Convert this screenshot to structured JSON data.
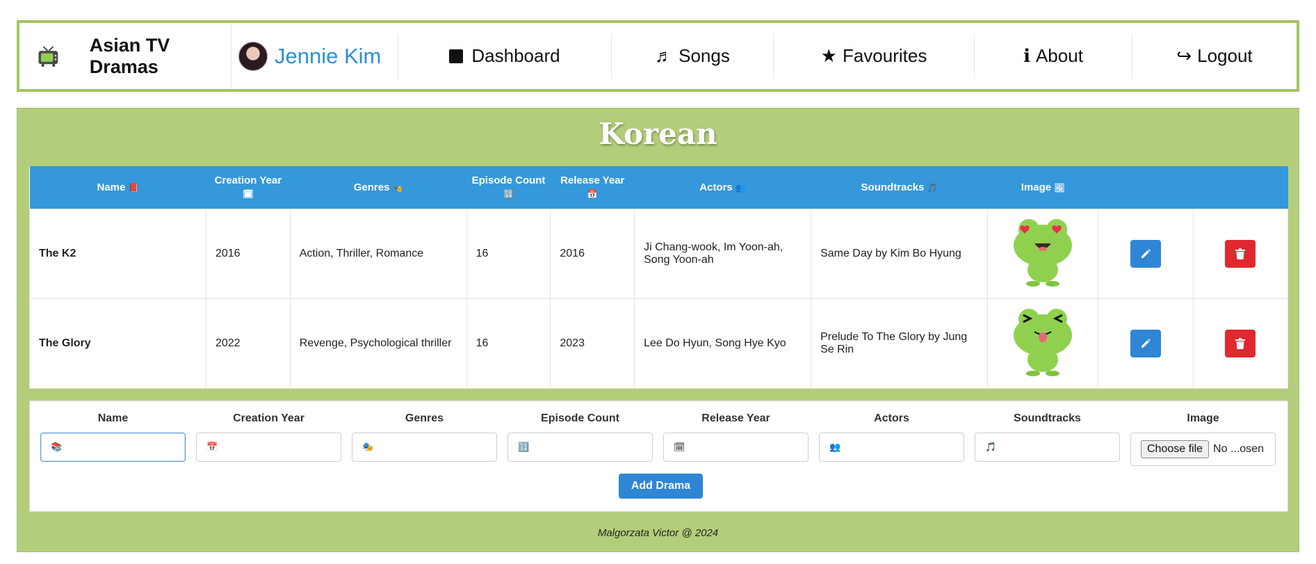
{
  "app": {
    "title": "Asian TV Dramas",
    "user_name": "Jennie Kim"
  },
  "nav": [
    {
      "label": "Dashboard",
      "icon": "square-icon"
    },
    {
      "label": "Songs",
      "icon": "♬"
    },
    {
      "label": "Favourites",
      "icon": "★"
    },
    {
      "label": "About",
      "icon": "ℹ"
    },
    {
      "label": "Logout",
      "icon": "↪"
    }
  ],
  "panel": {
    "title": "Korean"
  },
  "table": {
    "headers": [
      {
        "label": "Name",
        "icon": "📕"
      },
      {
        "label": "Creation Year",
        "icon": "🗓"
      },
      {
        "label": "Genres",
        "icon": "🎭"
      },
      {
        "label": "Episode Count",
        "icon": "🔢"
      },
      {
        "label": "Release Year",
        "icon": "📅"
      },
      {
        "label": "Actors",
        "icon": "👥"
      },
      {
        "label": "Soundtracks",
        "icon": "🎵"
      },
      {
        "label": "Image",
        "icon": "🖼"
      }
    ],
    "rows": [
      {
        "name": "The K2",
        "creation_year": "2016",
        "genres": "Action, Thriller, Romance",
        "episode_count": "16",
        "release_year": "2016",
        "actors": "Ji Chang-wook, Im Yoon-ah, Song Yoon-ah",
        "soundtracks": "Same Day by Kim Bo Hyung",
        "image": "frog-heart-eyes"
      },
      {
        "name": "The Glory",
        "creation_year": "2022",
        "genres": "Revenge, Psychological thriller",
        "episode_count": "16",
        "release_year": "2023",
        "actors": "Lee Do Hyun, Song Hye Kyo",
        "soundtracks": "Prelude To The Glory by Jung Se Rin",
        "image": "frog-tongue"
      }
    ]
  },
  "form": {
    "fields": [
      {
        "label": "Name",
        "icon": "📚"
      },
      {
        "label": "Creation Year",
        "icon": "📅"
      },
      {
        "label": "Genres",
        "icon": "🎭"
      },
      {
        "label": "Episode Count",
        "icon": "🔢"
      },
      {
        "label": "Release Year",
        "icon": "🗓"
      },
      {
        "label": "Actors",
        "icon": "👥"
      },
      {
        "label": "Soundtracks",
        "icon": "🎵"
      },
      {
        "label": "Image",
        "icon": ""
      }
    ],
    "file_button": "Choose file",
    "file_status": "No ...osen",
    "submit_label": "Add Drama"
  },
  "footer": {
    "text": "Malgorzata Victor @ 2024"
  },
  "colors": {
    "accent_green": "#b3cd7a",
    "header_blue": "#3498db",
    "edit_blue": "#2e86d4",
    "delete_red": "#e0282f"
  }
}
